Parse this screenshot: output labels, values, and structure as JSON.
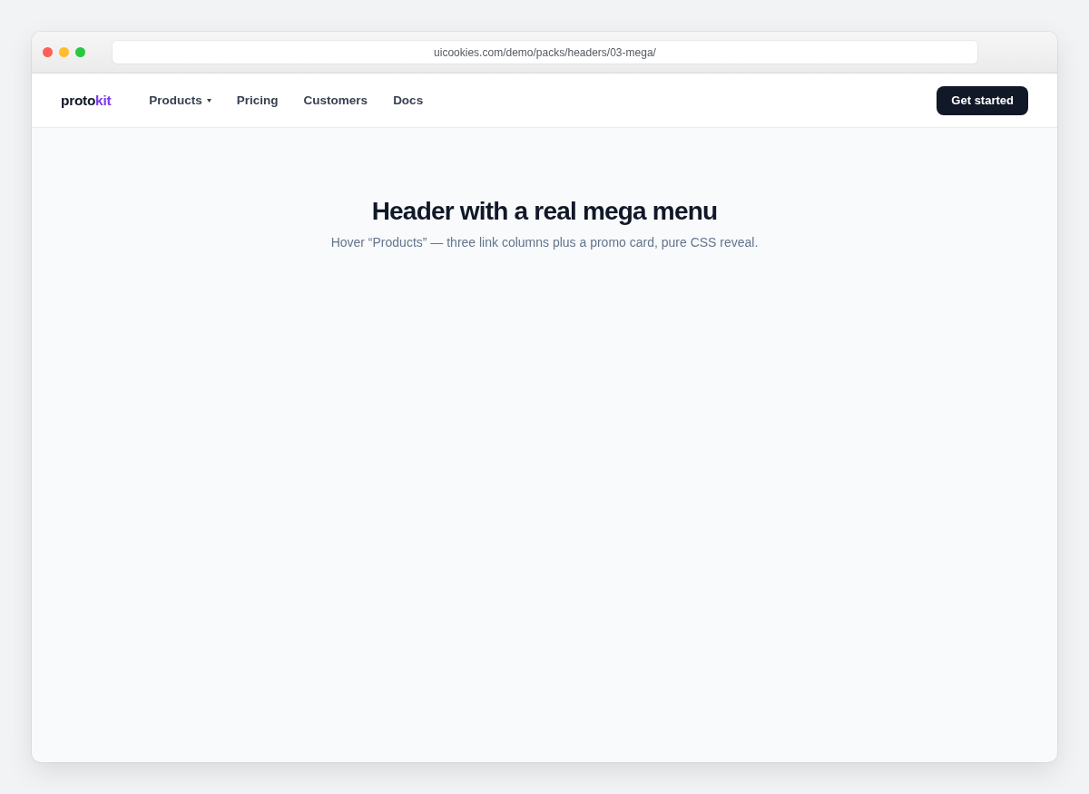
{
  "browser": {
    "url": "uicookies.com/demo/packs/headers/03-mega/"
  },
  "header": {
    "logo": {
      "text": "proto",
      "accent_text": "kit"
    },
    "nav": [
      {
        "label": "Products",
        "has_menu": true
      },
      {
        "label": "Pricing",
        "has_menu": false
      },
      {
        "label": "Customers",
        "has_menu": false
      },
      {
        "label": "Docs",
        "has_menu": false
      }
    ],
    "cta": {
      "label": "Get started"
    }
  },
  "hero": {
    "title": "Header with a real mega menu",
    "subtitle": "Hover “Products” — three link columns plus a promo card, pure CSS reveal."
  }
}
